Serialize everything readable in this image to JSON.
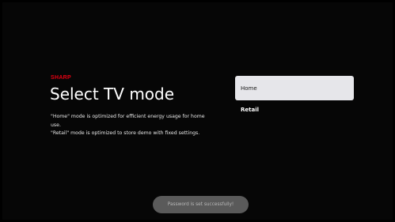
{
  "brand": {
    "logo_text": "SHARP",
    "color": "#e60012"
  },
  "setup": {
    "title": "Select TV mode",
    "description": [
      "\"Home\" mode is optimized for efficient energy usage for home use.",
      "\"Retail\" mode is optimized to store demo with fixed settings."
    ]
  },
  "options": [
    {
      "label": "Home",
      "selected": true
    },
    {
      "label": "Retail",
      "selected": false
    }
  ],
  "toast": {
    "message": "Password is set successfully!"
  },
  "colors": {
    "background": "#060606",
    "selected_option_bg": "#e6e6ea",
    "toast_bg": "#5a5a5a"
  }
}
